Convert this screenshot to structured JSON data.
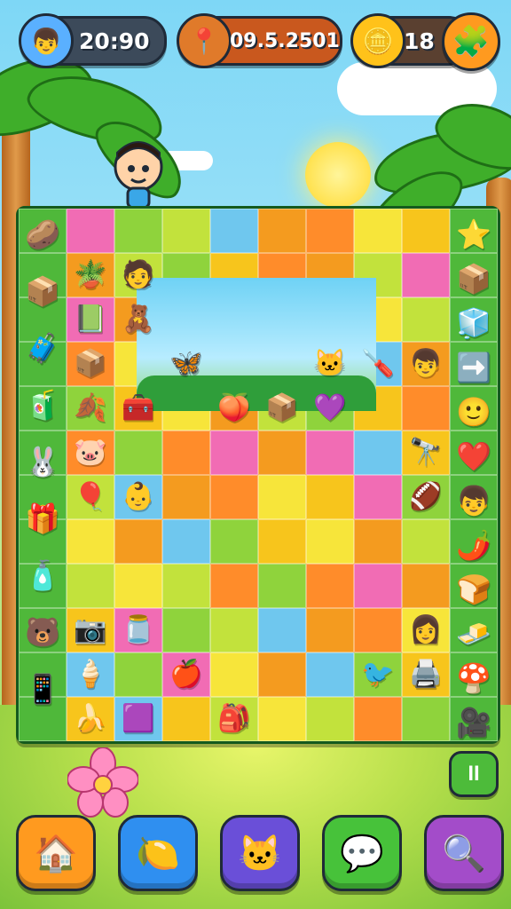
{
  "hud": {
    "timer": "20:90",
    "coins": "09.5.2501",
    "gold_count": "18",
    "avatar_icon": "boy-face-icon",
    "location_icon": "map-pin-icon",
    "gold_icon": "gold-coin-icon",
    "puzzle_icon": "puzzle-piece-icon"
  },
  "left_column": [
    "🥔",
    "📦",
    "🧳",
    "🧃",
    "🐰",
    "🎁",
    "🧴",
    "🐻",
    "📱"
  ],
  "right_column": [
    "⭐",
    "📦",
    "🧊",
    "➡️",
    "🙂",
    "❤️",
    "👦",
    "🌶️",
    "🍞",
    "🧈",
    "🍄",
    "🎥"
  ],
  "board_pieces": [
    {
      "icon": "🪴",
      "col": 1,
      "row": 1
    },
    {
      "icon": "🧑",
      "col": 2,
      "row": 1
    },
    {
      "icon": "📗",
      "col": 1,
      "row": 2
    },
    {
      "icon": "🧸",
      "col": 2,
      "row": 2
    },
    {
      "icon": "📦",
      "col": 1,
      "row": 3
    },
    {
      "icon": "🦋",
      "col": 3,
      "row": 3
    },
    {
      "icon": "🐱",
      "col": 6,
      "row": 3
    },
    {
      "icon": "🪛",
      "col": 7,
      "row": 3
    },
    {
      "icon": "👦",
      "col": 8,
      "row": 3
    },
    {
      "icon": "🍂",
      "col": 1,
      "row": 4
    },
    {
      "icon": "🧰",
      "col": 2,
      "row": 4
    },
    {
      "icon": "🍑",
      "col": 4,
      "row": 4
    },
    {
      "icon": "📦",
      "col": 5,
      "row": 4
    },
    {
      "icon": "💜",
      "col": 6,
      "row": 4
    },
    {
      "icon": "🐷",
      "col": 1,
      "row": 5
    },
    {
      "icon": "🎈",
      "col": 1,
      "row": 6
    },
    {
      "icon": "👶",
      "col": 2,
      "row": 6
    },
    {
      "icon": "🔭",
      "col": 8,
      "row": 5
    },
    {
      "icon": "🏈",
      "col": 8,
      "row": 6
    },
    {
      "icon": "📷",
      "col": 1,
      "row": 9
    },
    {
      "icon": "🫙",
      "col": 2,
      "row": 9
    },
    {
      "icon": "👩",
      "col": 8,
      "row": 9
    },
    {
      "icon": "🍦",
      "col": 1,
      "row": 10
    },
    {
      "icon": "🍎",
      "col": 3,
      "row": 10
    },
    {
      "icon": "🐦",
      "col": 7,
      "row": 10
    },
    {
      "icon": "🖨️",
      "col": 8,
      "row": 10
    },
    {
      "icon": "🍌",
      "col": 1,
      "row": 11
    },
    {
      "icon": "🟪",
      "col": 2,
      "row": 11
    },
    {
      "icon": "🎒",
      "col": 4,
      "row": 11
    }
  ],
  "controls": [
    {
      "name": "home-button",
      "icon": "🏠",
      "color": "#ff9a1f"
    },
    {
      "name": "hint-button",
      "icon": "🍋",
      "color": "#2f8ff0"
    },
    {
      "name": "character-button",
      "icon": "🐱",
      "color": "#6a4fd8"
    },
    {
      "name": "chat-button",
      "icon": "💬",
      "color": "#47c23a"
    },
    {
      "name": "search-button",
      "icon": "🔍",
      "color": "#a34cc9"
    }
  ],
  "pause_label": "II"
}
